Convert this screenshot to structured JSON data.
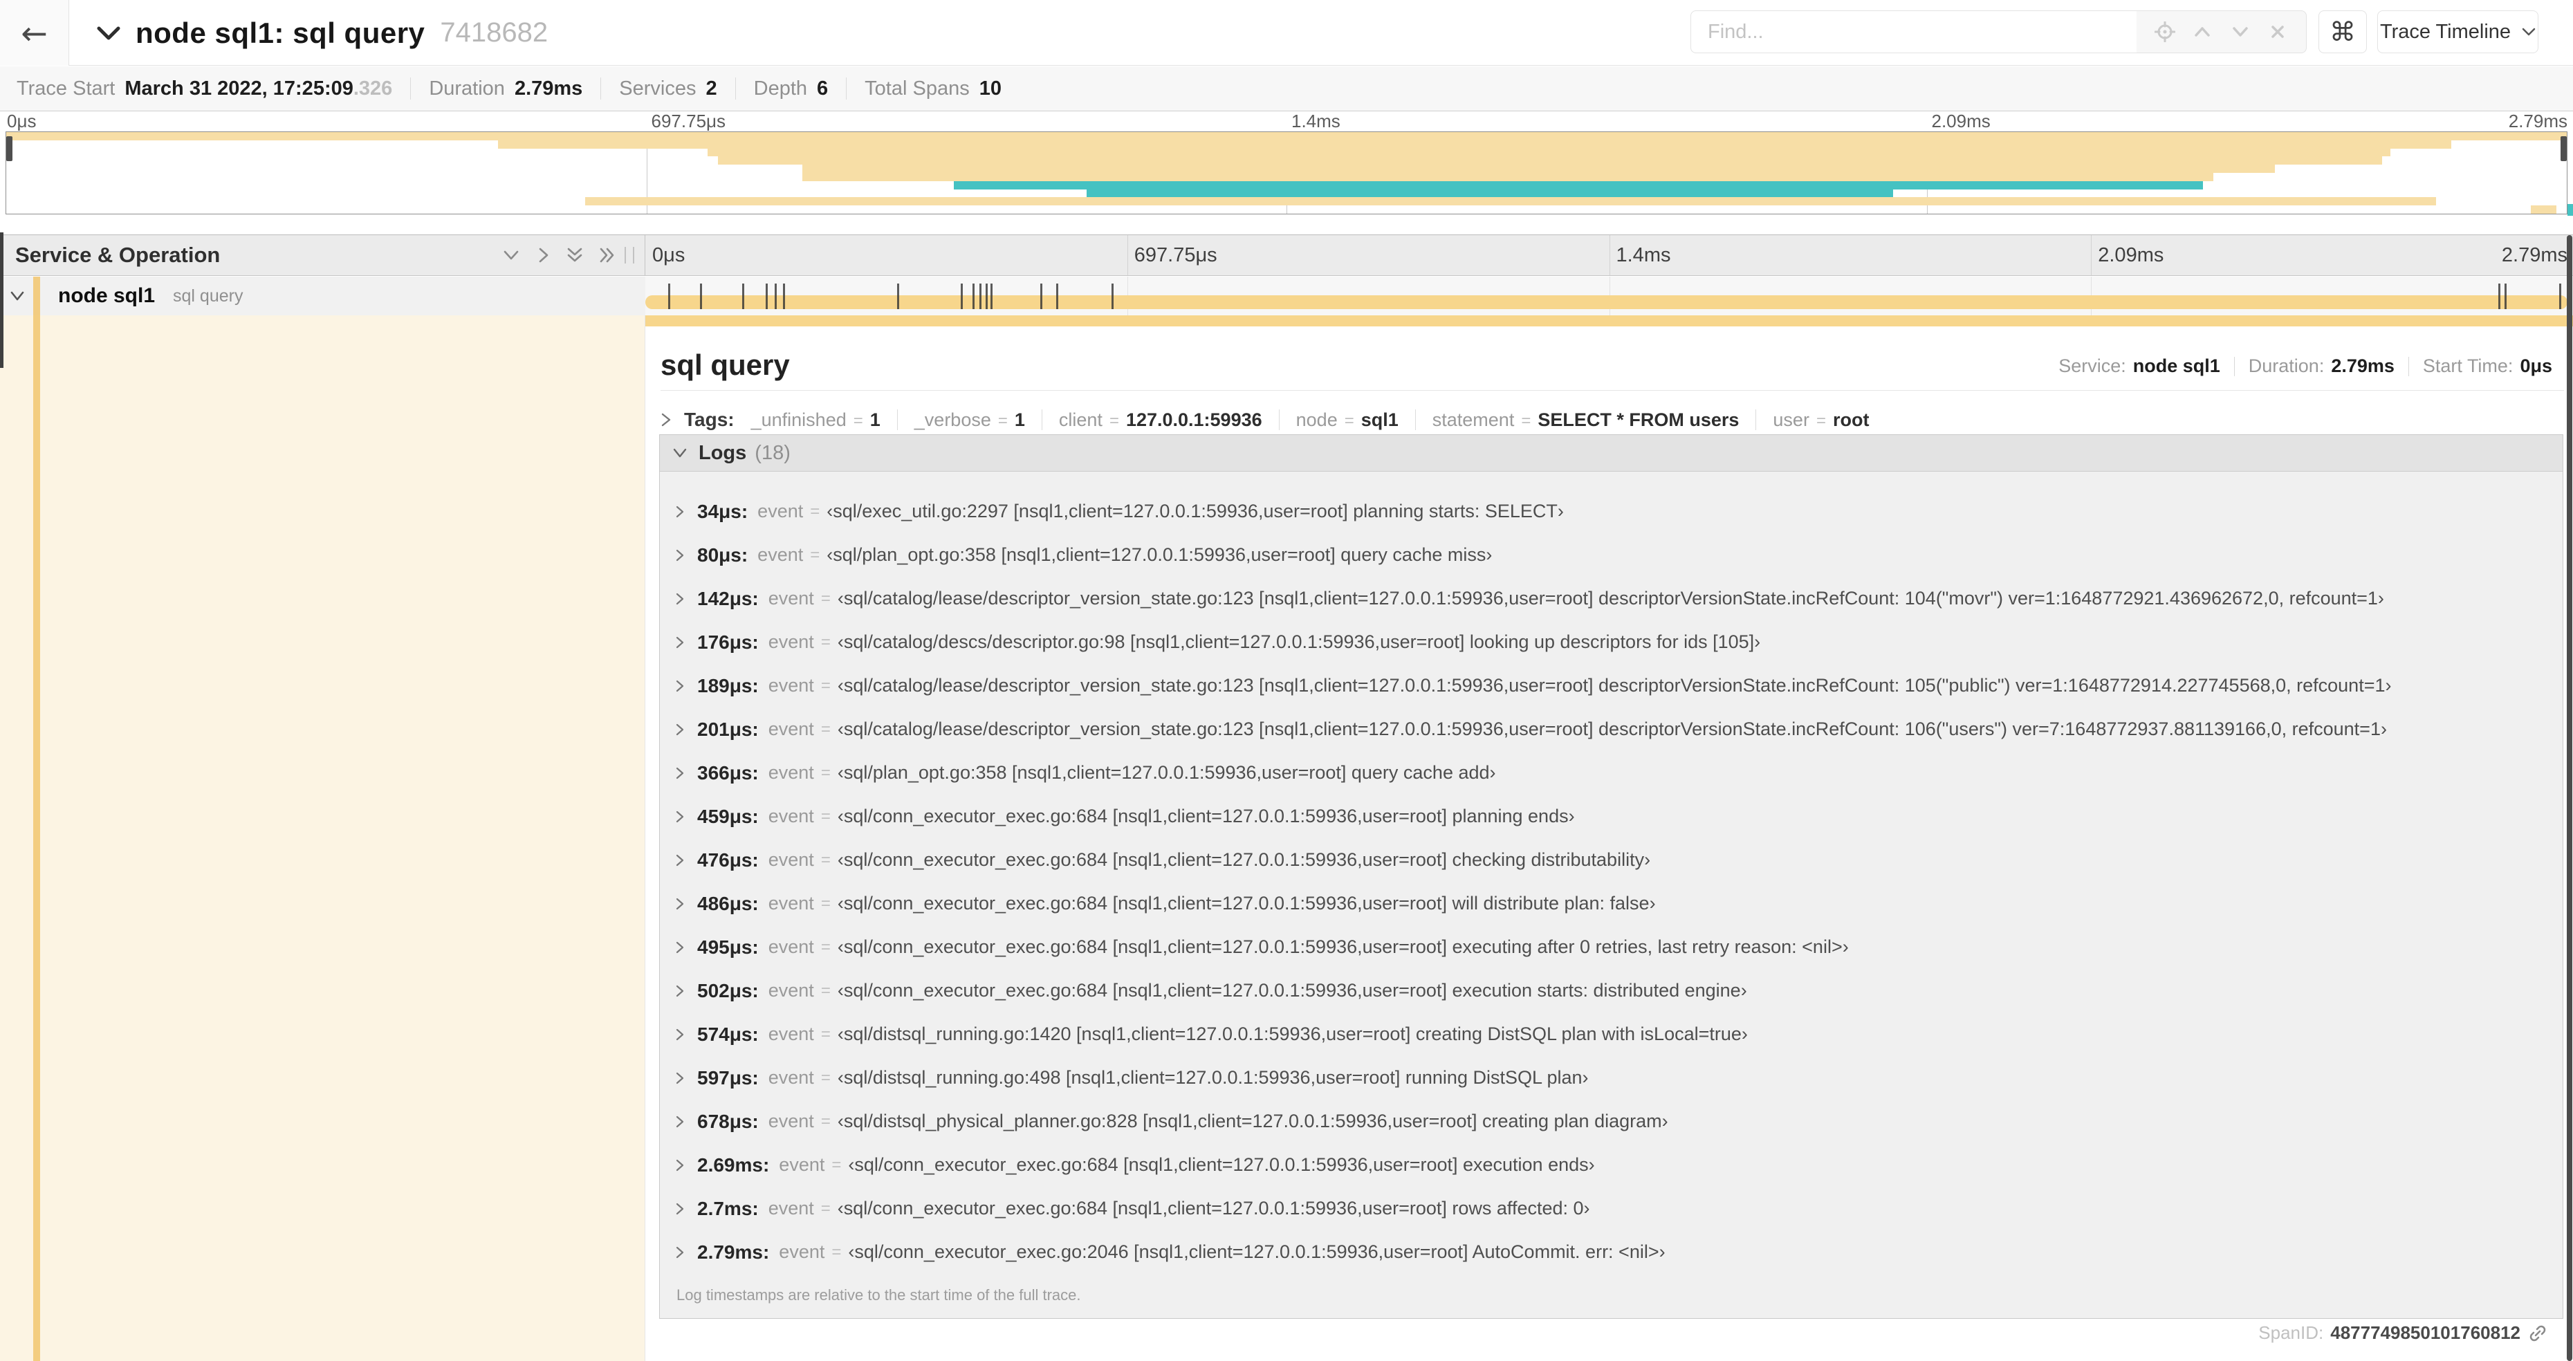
{
  "header": {
    "back_icon": "←",
    "title": "node sql1: sql query",
    "trace_id": "7418682",
    "find_placeholder": "Find...",
    "shortcut_button": "⌘",
    "view_selector": "Trace Timeline"
  },
  "summary": {
    "items": [
      {
        "label": "Trace Start",
        "value": "March 31 2022, 17:25:09",
        "suffix": ".326"
      },
      {
        "label": "Duration",
        "value": "2.79ms",
        "suffix": ""
      },
      {
        "label": "Services",
        "value": "2",
        "suffix": ""
      },
      {
        "label": "Depth",
        "value": "6",
        "suffix": ""
      },
      {
        "label": "Total Spans",
        "value": "10",
        "suffix": ""
      }
    ]
  },
  "axis_ticks": [
    "0μs",
    "697.75μs",
    "1.4ms",
    "2.09ms",
    "2.79ms"
  ],
  "minimap": {
    "spans": [
      {
        "start": 0.0,
        "end": 1.0,
        "color": "tan"
      },
      {
        "start": 0.192,
        "end": 0.955,
        "color": "tan"
      },
      {
        "start": 0.274,
        "end": 0.931,
        "color": "tan"
      },
      {
        "start": 0.278,
        "end": 0.928,
        "color": "tan"
      },
      {
        "start": 0.311,
        "end": 0.886,
        "color": "tan"
      },
      {
        "start": 0.311,
        "end": 0.862,
        "color": "tan"
      },
      {
        "start": 0.37,
        "end": 0.858,
        "color": "teal"
      },
      {
        "start": 0.422,
        "end": 0.737,
        "color": "teal"
      },
      {
        "start": 0.226,
        "end": 0.949,
        "color": "tan"
      },
      {
        "start": 0.986,
        "end": 0.996,
        "color": "tan"
      }
    ]
  },
  "timeline": {
    "column_header": "Service & Operation",
    "row": {
      "service": "node sql1",
      "operation": "sql query"
    },
    "log_marker_fractions": [
      0.0122,
      0.0287,
      0.0509,
      0.0631,
      0.0677,
      0.072,
      0.1312,
      0.1645,
      0.1706,
      0.1742,
      0.1774,
      0.18,
      0.2057,
      0.214,
      0.243,
      0.9642,
      0.9677,
      0.999
    ]
  },
  "detail": {
    "title": "sql query",
    "meta": [
      {
        "label": "Service:",
        "value": "node sql1"
      },
      {
        "label": "Duration:",
        "value": "2.79ms"
      },
      {
        "label": "Start Time:",
        "value": "0μs"
      }
    ],
    "tags_label": "Tags:",
    "tags": [
      {
        "key": "_unfinished",
        "value": "1"
      },
      {
        "key": "_verbose",
        "value": "1"
      },
      {
        "key": "client",
        "value": "127.0.0.1:59936"
      },
      {
        "key": "node",
        "value": "sql1"
      },
      {
        "key": "statement",
        "value": "SELECT * FROM users"
      },
      {
        "key": "user",
        "value": "root"
      }
    ],
    "logs_label": "Logs",
    "logs_count": "(18)",
    "logs": [
      {
        "time": "34μs:",
        "key": "event",
        "value": "‹sql/exec_util.go:2297 [nsql1,client=127.0.0.1:59936,user=root] planning starts: SELECT›"
      },
      {
        "time": "80μs:",
        "key": "event",
        "value": "‹sql/plan_opt.go:358 [nsql1,client=127.0.0.1:59936,user=root] query cache miss›"
      },
      {
        "time": "142μs:",
        "key": "event",
        "value": "‹sql/catalog/lease/descriptor_version_state.go:123 [nsql1,client=127.0.0.1:59936,user=root] descriptorVersionState.incRefCount: 104(\"movr\") ver=1:1648772921.436962672,0, refcount=1›"
      },
      {
        "time": "176μs:",
        "key": "event",
        "value": "‹sql/catalog/descs/descriptor.go:98 [nsql1,client=127.0.0.1:59936,user=root] looking up descriptors for ids [105]›"
      },
      {
        "time": "189μs:",
        "key": "event",
        "value": "‹sql/catalog/lease/descriptor_version_state.go:123 [nsql1,client=127.0.0.1:59936,user=root] descriptorVersionState.incRefCount: 105(\"public\") ver=1:1648772914.227745568,0, refcount=1›"
      },
      {
        "time": "201μs:",
        "key": "event",
        "value": "‹sql/catalog/lease/descriptor_version_state.go:123 [nsql1,client=127.0.0.1:59936,user=root] descriptorVersionState.incRefCount: 106(\"users\") ver=7:1648772937.881139166,0, refcount=1›"
      },
      {
        "time": "366μs:",
        "key": "event",
        "value": "‹sql/plan_opt.go:358 [nsql1,client=127.0.0.1:59936,user=root] query cache add›"
      },
      {
        "time": "459μs:",
        "key": "event",
        "value": "‹sql/conn_executor_exec.go:684 [nsql1,client=127.0.0.1:59936,user=root] planning ends›"
      },
      {
        "time": "476μs:",
        "key": "event",
        "value": "‹sql/conn_executor_exec.go:684 [nsql1,client=127.0.0.1:59936,user=root] checking distributability›"
      },
      {
        "time": "486μs:",
        "key": "event",
        "value": "‹sql/conn_executor_exec.go:684 [nsql1,client=127.0.0.1:59936,user=root] will distribute plan: false›"
      },
      {
        "time": "495μs:",
        "key": "event",
        "value": "‹sql/conn_executor_exec.go:684 [nsql1,client=127.0.0.1:59936,user=root] executing after 0 retries, last retry reason: <nil>›"
      },
      {
        "time": "502μs:",
        "key": "event",
        "value": "‹sql/conn_executor_exec.go:684 [nsql1,client=127.0.0.1:59936,user=root] execution starts: distributed engine›"
      },
      {
        "time": "574μs:",
        "key": "event",
        "value": "‹sql/distsql_running.go:1420 [nsql1,client=127.0.0.1:59936,user=root] creating DistSQL plan with isLocal=true›"
      },
      {
        "time": "597μs:",
        "key": "event",
        "value": "‹sql/distsql_running.go:498 [nsql1,client=127.0.0.1:59936,user=root] running DistSQL plan›"
      },
      {
        "time": "678μs:",
        "key": "event",
        "value": "‹sql/distsql_physical_planner.go:828 [nsql1,client=127.0.0.1:59936,user=root] creating plan diagram›"
      },
      {
        "time": "2.69ms:",
        "key": "event",
        "value": "‹sql/conn_executor_exec.go:684 [nsql1,client=127.0.0.1:59936,user=root] execution ends›"
      },
      {
        "time": "2.7ms:",
        "key": "event",
        "value": "‹sql/conn_executor_exec.go:684 [nsql1,client=127.0.0.1:59936,user=root] rows affected: 0›"
      },
      {
        "time": "2.79ms:",
        "key": "event",
        "value": "‹sql/conn_executor_exec.go:2046 [nsql1,client=127.0.0.1:59936,user=root] AutoCommit. err: <nil>›"
      }
    ],
    "logs_footer": "Log timestamps are relative to the start time of the full trace.",
    "spanid_label": "SpanID:",
    "spanid_value": "4877749850101760812"
  },
  "colors": {
    "span_tan": "#F7D68C",
    "minimap_tan": "#F7DEA6",
    "span_teal": "#45C2C2",
    "accent_tan": "#F2CC81",
    "detail_left_bg": "#FCF4E3"
  }
}
